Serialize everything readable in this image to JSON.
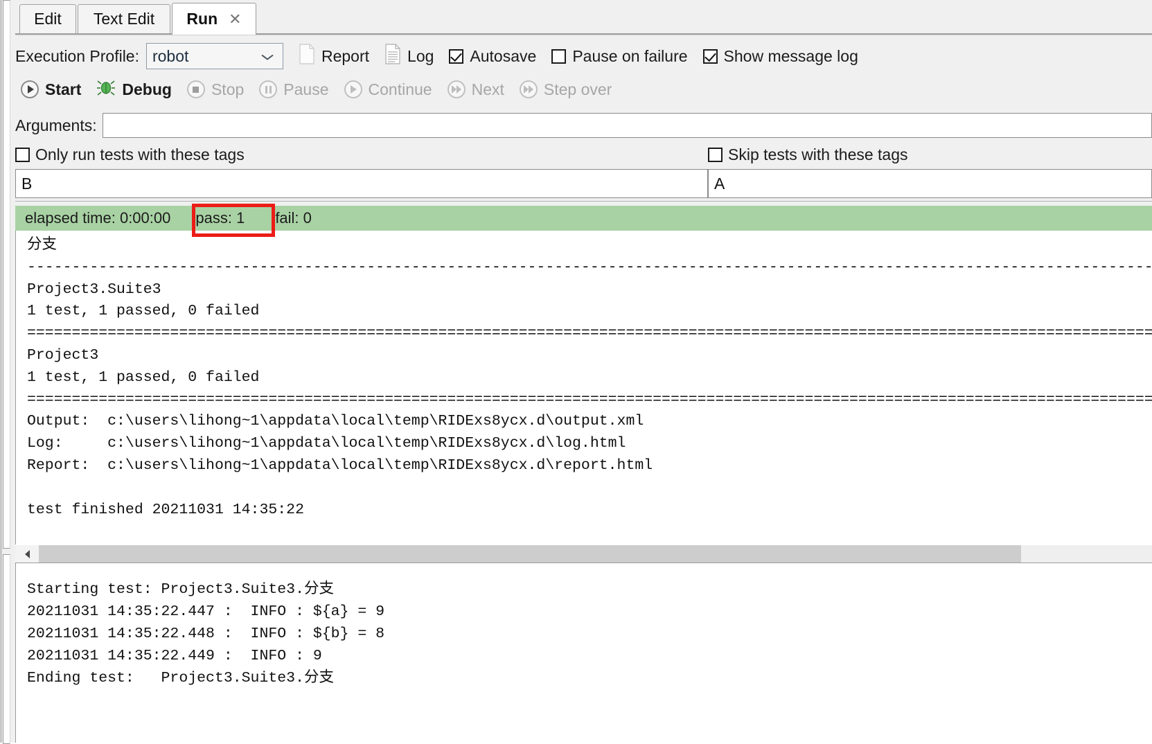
{
  "window": {
    "tabs": [
      {
        "label": "Edit",
        "active": false,
        "closable": false
      },
      {
        "label": "Text Edit",
        "active": false,
        "closable": false
      },
      {
        "label": "Run",
        "active": true,
        "closable": true,
        "close_glyph": "✕"
      }
    ]
  },
  "toolbar": {
    "execution_profile_label": "Execution Profile:",
    "execution_profile_value": "robot",
    "execution_profile_chevron": "⌄",
    "report_label": "Report",
    "log_label": "Log",
    "autosave_label": "Autosave",
    "autosave_checked": true,
    "pause_on_failure_label": "Pause on failure",
    "pause_on_failure_checked": false,
    "show_message_log_label": "Show message log",
    "show_message_log_checked": true
  },
  "controls": {
    "start_label": "Start",
    "debug_label": "Debug",
    "stop_label": "Stop",
    "pause_label": "Pause",
    "continue_label": "Continue",
    "next_label": "Next",
    "step_over_label": "Step over"
  },
  "arguments": {
    "label": "Arguments:",
    "value": "",
    "placeholder": ""
  },
  "tags": {
    "only_run_label": "Only run tests with these tags",
    "only_run_checked": false,
    "only_run_value": "B",
    "skip_label": "Skip tests with these tags",
    "skip_checked": false,
    "skip_value": "A"
  },
  "status": {
    "elapsed": "elapsed time: 0:00:00",
    "pass": "pass: 1",
    "fail": "fail: 0",
    "bar_color": "#a9d2a4",
    "highlight_color": "#ec1c17"
  },
  "console": {
    "text": "分支\n------------------------------------------------------------------------------------------------------------------------------------------------------------------\nProject3.Suite3\n1 test, 1 passed, 0 failed\n==================================================================================================================================================================\nProject3\n1 test, 1 passed, 0 failed\n==================================================================================================================================================================\nOutput:  c:\\users\\lihong~1\\appdata\\local\\temp\\RIDExs8ycx.d\\output.xml\nLog:     c:\\users\\lihong~1\\appdata\\local\\temp\\RIDExs8ycx.d\\log.html\nReport:  c:\\users\\lihong~1\\appdata\\local\\temp\\RIDExs8ycx.d\\report.html\n\ntest finished 20211031 14:35:22"
  },
  "message_log": {
    "text": "Starting test: Project3.Suite3.分支\n20211031 14:35:22.447 :  INFO : ${a} = 9\n20211031 14:35:22.448 :  INFO : ${b} = 8\n20211031 14:35:22.449 :  INFO : 9\nEnding test:   Project3.Suite3.分支"
  },
  "scrollbar": {
    "arrow_glyph": "‹"
  }
}
